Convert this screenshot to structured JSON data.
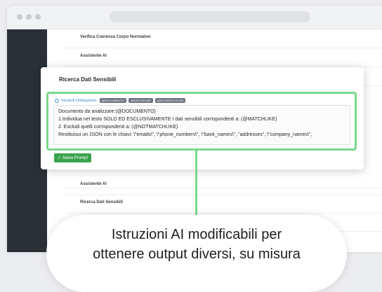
{
  "list": {
    "rows": [
      "Verifica Coerenza Corpo Normativo",
      "Assistente AI",
      "",
      "",
      "",
      "",
      "",
      "Assistente AI",
      "Ricerca Dati Sensibili"
    ]
  },
  "modal": {
    "title": "Ricerca Dati Sensibili",
    "variables_label": "Variabili Obbligatorie:",
    "variable_chips": [
      "@DOCUMENTO",
      "@MATCHLIKE",
      "@NOTMATCHLIKE"
    ],
    "prompt_lines": [
      "Documento da analizzare:(@DOCUMENTO)",
      "1.Individua nel testo SOLO ED ESCLUSIVAMENTE I dati sensibili corrispondenti a:  (@MATCHLIKE)",
      "2. Escludi quelli corrispondenti a:  (@NOTMATCHLIKE)",
      "Restituisui un JSON con le chiavi:  \\\"emails\\\", \\\"phone_numbers\\\", \\\"bank_names\\\", \"addresses\", \\\"company_names\\\","
    ],
    "save_label": "Salva Prompt"
  },
  "callout": {
    "line1": "Istruzioni AI modificabili per",
    "line2": "ottenere output diversi, su misura"
  },
  "colors": {
    "accent_green": "#7bd88b",
    "button_green": "#3aa34e",
    "sidebar": "#2b3037",
    "link_blue": "#3f8fd6"
  }
}
